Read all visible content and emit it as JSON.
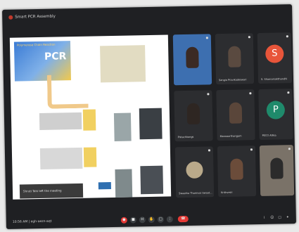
{
  "meeting": {
    "title": "Smart PCR Assembly"
  },
  "slide": {
    "banner_heading": "Polymerase Chain Reaction",
    "banner_title": "PCR"
  },
  "notice": "Shruti Tahi left the meeting",
  "participants": [
    {
      "name": "",
      "type": "video"
    },
    {
      "name": "Sangia Pravikadeswari",
      "type": "video"
    },
    {
      "name": "S. Shamarsakthandhi",
      "type": "avatar",
      "initial": "S",
      "color": "#e8553a"
    },
    {
      "name": "Pistachkongs",
      "type": "video"
    },
    {
      "name": "Manoaarthangam",
      "type": "video"
    },
    {
      "name": "PECO Allika",
      "type": "avatar",
      "initial": "P",
      "color": "#1f8a6b"
    },
    {
      "name": "Swaatha Thamivai Swaat...",
      "type": "video"
    },
    {
      "name": "Krithvetri",
      "type": "video"
    },
    {
      "name": "",
      "type": "video"
    }
  ],
  "bottom_bar": {
    "clock": "10:56 AM | egh-aezn-aqt"
  },
  "controls": [
    {
      "name": "mic-button",
      "glyph": "●"
    },
    {
      "name": "camera-button",
      "glyph": "■"
    },
    {
      "name": "captions-button",
      "glyph": "H"
    },
    {
      "name": "raise-hand-button",
      "glyph": "✋"
    },
    {
      "name": "present-button",
      "glyph": "□"
    },
    {
      "name": "more-options-button",
      "glyph": "⋮"
    }
  ],
  "end_call_color": "#e53935",
  "utilities": [
    {
      "name": "info-icon",
      "glyph": "i"
    },
    {
      "name": "people-icon",
      "glyph": "☺"
    },
    {
      "name": "chat-icon",
      "glyph": "▢"
    },
    {
      "name": "activities-icon",
      "glyph": "✦"
    }
  ]
}
